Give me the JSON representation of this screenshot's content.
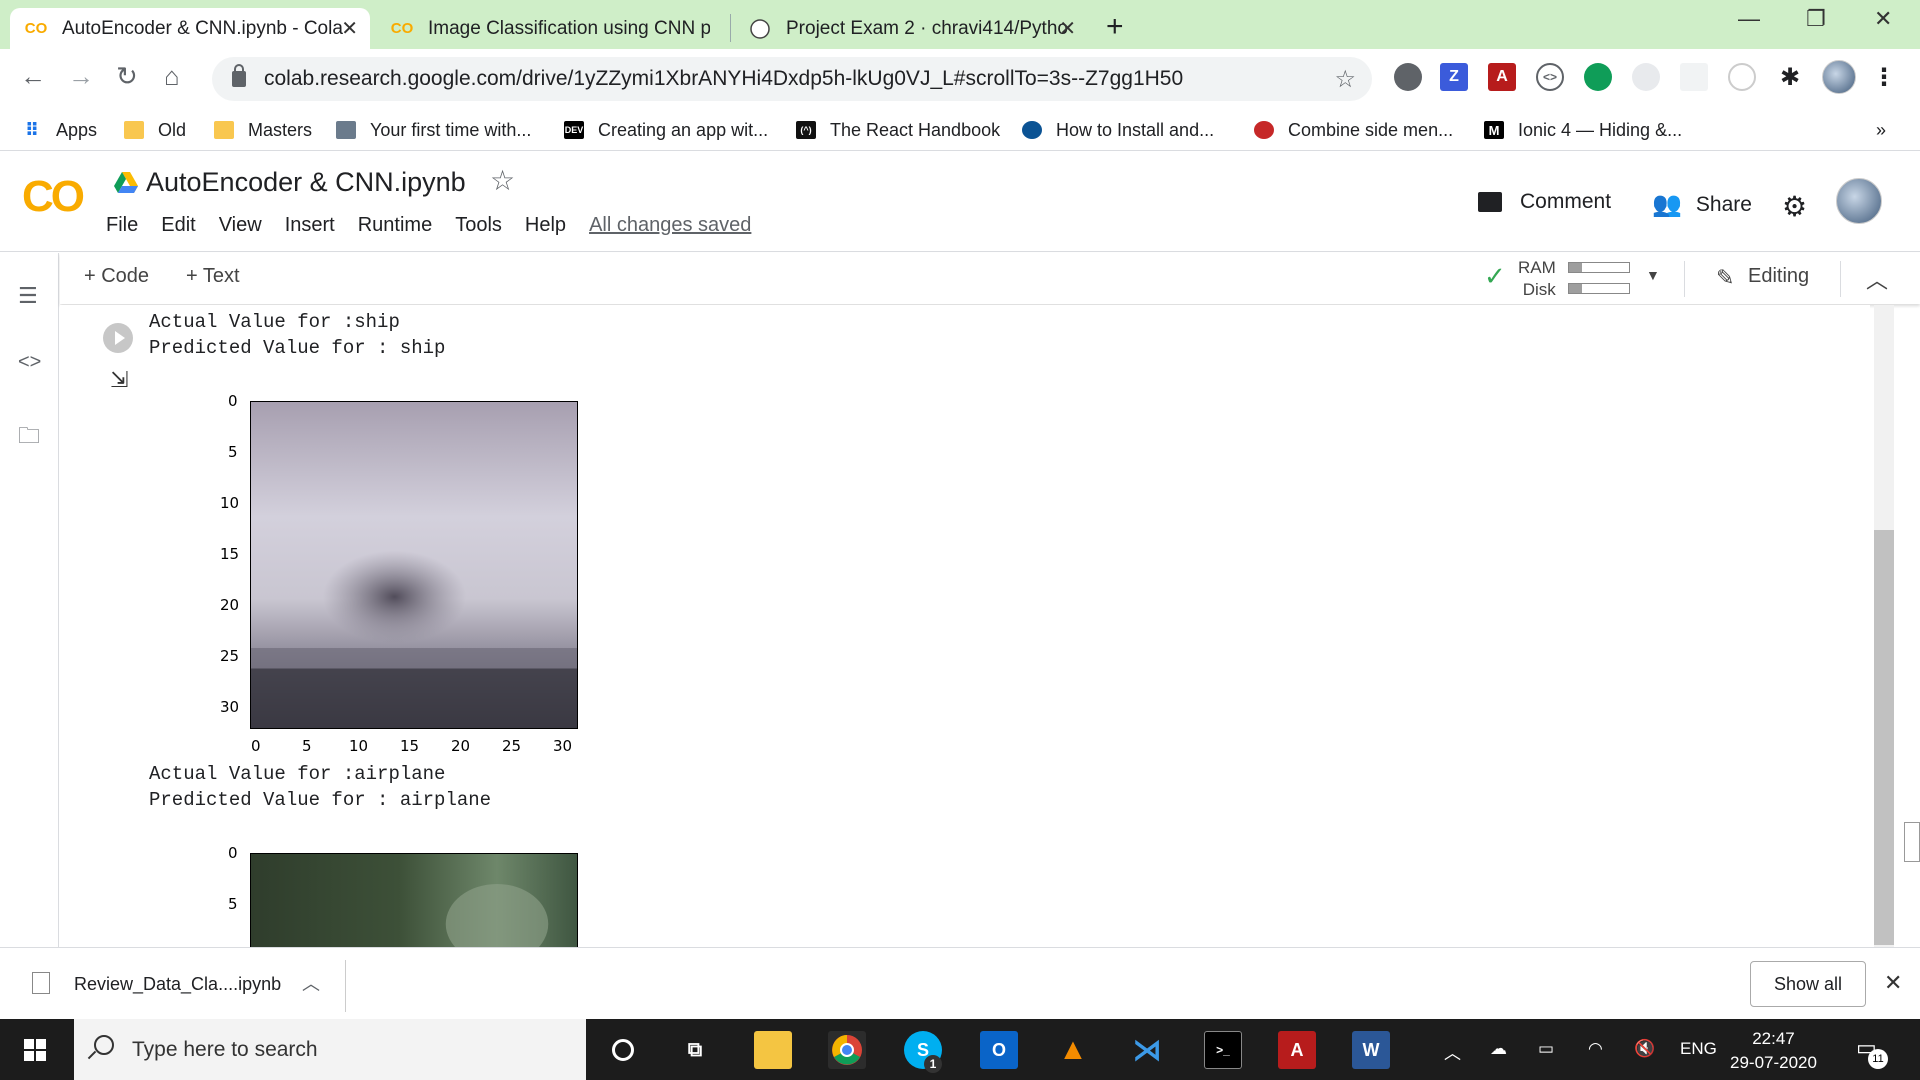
{
  "browser": {
    "tabs": [
      {
        "title": "AutoEncoder & CNN.ipynb - Cola",
        "active": true
      },
      {
        "title": "Image Classification using CNN p",
        "active": false
      },
      {
        "title": "Project Exam 2 · chravi414/Pytho",
        "active": false
      }
    ],
    "url": "colab.research.google.com/drive/1yZZymi1XbrANYHi4Dxdp5h-lkUg0VJ_L#scrollTo=3s--Z7gg1H50",
    "bookmarks": [
      "Apps",
      "Old",
      "Masters",
      "Your first time with...",
      "Creating an app wit...",
      "The React Handbook",
      "How to Install and...",
      "Combine side men...",
      "Ionic 4 — Hiding &..."
    ],
    "bookmarks_more": "»"
  },
  "colab": {
    "logo": "CO",
    "title": "AutoEncoder & CNN.ipynb",
    "menu": [
      "File",
      "Edit",
      "View",
      "Insert",
      "Runtime",
      "Tools",
      "Help"
    ],
    "saved_status": "All changes saved",
    "comment_label": "Comment",
    "share_label": "Share",
    "add_code_label": "+ Code",
    "add_text_label": "+ Text",
    "ram_label": "RAM",
    "disk_label": "Disk",
    "ram_fill": 0.22,
    "disk_fill": 0.22,
    "editing_label": "Editing"
  },
  "output": {
    "block1": {
      "actual": "Actual Value for :ship",
      "predicted": "Predicted Value for : ship"
    },
    "block2": {
      "actual": "Actual Value for :airplane",
      "predicted": "Predicted Value for : airplane"
    },
    "y_ticks": [
      "0",
      "5",
      "10",
      "15",
      "20",
      "25",
      "30"
    ],
    "x_ticks": [
      "0",
      "5",
      "10",
      "15",
      "20",
      "25",
      "30"
    ],
    "y_ticks_partial": [
      "0",
      "5"
    ]
  },
  "downloads": {
    "file_name": "Review_Data_Cla....ipynb",
    "show_all_label": "Show all"
  },
  "taskbar": {
    "search_placeholder": "Type here to search",
    "skype_badge": "1",
    "lang": "ENG",
    "time": "22:47",
    "date": "29-07-2020",
    "notification_count": "11"
  }
}
